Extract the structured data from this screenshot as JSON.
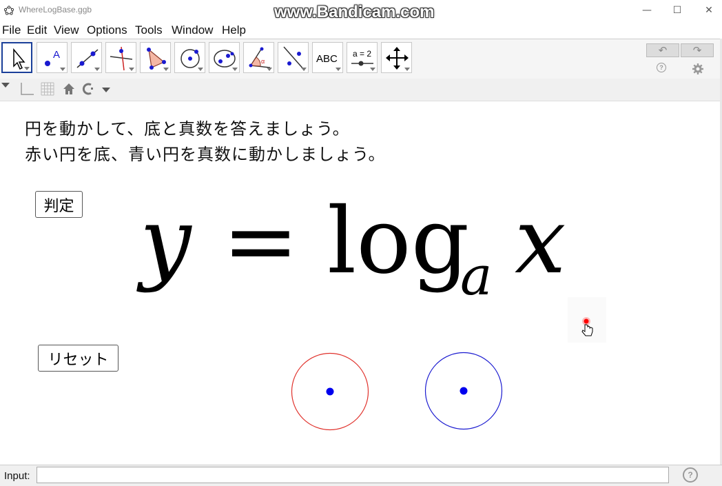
{
  "window": {
    "title": "WhereLogBase.ggb",
    "watermark": "www.Bandicam.com",
    "controls": [
      "—",
      "☐",
      "✕"
    ]
  },
  "menu": [
    "File",
    "Edit",
    "View",
    "Options",
    "Tools",
    "Window",
    "Help"
  ],
  "toolbar": {
    "tools": [
      {
        "name": "move-tool-icon",
        "active": true
      },
      {
        "name": "point-tool-icon"
      },
      {
        "name": "line-tool-icon"
      },
      {
        "name": "perpendicular-line-tool-icon"
      },
      {
        "name": "polygon-tool-icon"
      },
      {
        "name": "circle-tool-icon"
      },
      {
        "name": "ellipse-tool-icon"
      },
      {
        "name": "angle-tool-icon"
      },
      {
        "name": "reflect-tool-icon"
      },
      {
        "name": "text-tool-icon",
        "label": "ABC"
      },
      {
        "name": "slider-tool-icon",
        "label": "a = 2"
      },
      {
        "name": "move-graphics-view-tool-icon"
      }
    ],
    "undo": "↶",
    "redo": "↷"
  },
  "graphics": {
    "instruction_line1": "円を動かして、底と真数を答えましょう。",
    "instruction_line2": "赤い円を底、青い円を真数に動かしましょう。",
    "judge_button": "判定",
    "reset_button": "リセット",
    "formula": {
      "y": "y",
      "equals": "=",
      "log": "log",
      "base": "a",
      "x": "x"
    },
    "colors": {
      "base_circle": "#e0302a",
      "arg_circle": "#1a1ad0",
      "point": "#0000ee",
      "pointer_dot": "#ff0000"
    }
  },
  "input_bar": {
    "label": "Input:",
    "value": ""
  }
}
